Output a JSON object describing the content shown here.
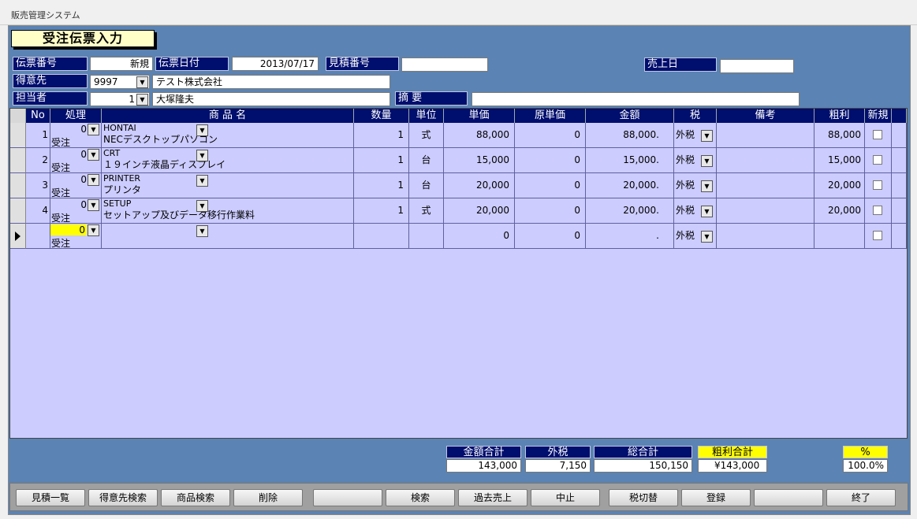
{
  "window": {
    "title": "販売管理システム"
  },
  "form_title": "受注伝票入力",
  "header": {
    "slip_no_label": "伝票番号",
    "slip_no_value": "新規",
    "slip_date_label": "伝票日付",
    "slip_date_value": "2013/07/17",
    "estimate_no_label": "見積番号",
    "estimate_no_value": "",
    "sales_date_label": "売上日",
    "sales_date_value": "",
    "customer_label": "得意先",
    "customer_code": "9997",
    "customer_name": "テスト株式会社",
    "staff_label": "担当者",
    "staff_code": "1",
    "staff_name": "大塚隆夫",
    "memo_label": "摘 要",
    "memo_value": ""
  },
  "columns": [
    "No",
    "処理",
    "商 品 名",
    "数量",
    "単位",
    "単価",
    "原単価",
    "金額",
    "税",
    "備考",
    "粗利",
    "新規"
  ],
  "rows": [
    {
      "no": "1",
      "proc_code": "0",
      "proc_label": "受注",
      "code": "HONTAI",
      "name": "NECデスクトップパソコン",
      "qty": "1",
      "unit": "式",
      "price": "88,000",
      "cost": "0",
      "amount": "88,000.",
      "tax": "外税",
      "note": "",
      "profit": "88,000"
    },
    {
      "no": "2",
      "proc_code": "0",
      "proc_label": "受注",
      "code": "CRT",
      "name": "１９インチ液晶ディスプレイ",
      "qty": "1",
      "unit": "台",
      "price": "15,000",
      "cost": "0",
      "amount": "15,000.",
      "tax": "外税",
      "note": "",
      "profit": "15,000"
    },
    {
      "no": "3",
      "proc_code": "0",
      "proc_label": "受注",
      "code": "PRINTER",
      "name": "プリンタ",
      "qty": "1",
      "unit": "台",
      "price": "20,000",
      "cost": "0",
      "amount": "20,000.",
      "tax": "外税",
      "note": "",
      "profit": "20,000"
    },
    {
      "no": "4",
      "proc_code": "0",
      "proc_label": "受注",
      "code": "SETUP",
      "name": "セットアップ及びデータ移行作業料",
      "qty": "1",
      "unit": "式",
      "price": "20,000",
      "cost": "0",
      "amount": "20,000.",
      "tax": "外税",
      "note": "",
      "profit": "20,000"
    },
    {
      "no": "",
      "proc_code": "0",
      "proc_label": "受注",
      "code": "",
      "name": "",
      "qty": "",
      "unit": "",
      "price": "0",
      "cost": "0",
      "amount": ".",
      "tax": "外税",
      "note": "",
      "profit": ""
    }
  ],
  "totals": {
    "amount_label": "金額合計",
    "amount_value": "143,000",
    "tax_label": "外税",
    "tax_value": "7,150",
    "grand_label": "総合計",
    "grand_value": "150,150",
    "profit_label": "粗利合計",
    "profit_value": "¥143,000",
    "pct_label": "%",
    "pct_value": "100.0%"
  },
  "buttons": [
    "見積一覧",
    "得意先検索",
    "商品検索",
    "削除",
    "",
    "検索",
    "過去売上",
    "中止",
    "税切替",
    "登録",
    "",
    "終了"
  ],
  "colors": {
    "form_bg": "#5b83b3",
    "label_bg": "#000e6e",
    "grid_bg": "#ccccff",
    "highlight": "#ffff00"
  }
}
